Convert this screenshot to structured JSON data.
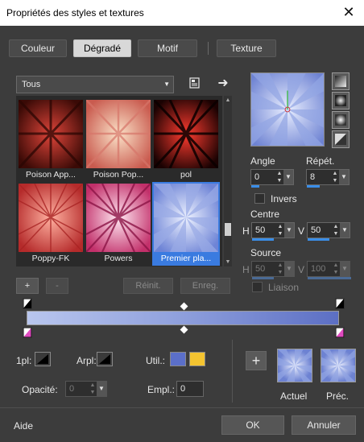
{
  "window": {
    "title": "Propriétés des styles et textures",
    "close_glyph": "✕"
  },
  "tabs": [
    {
      "label": "Couleur"
    },
    {
      "label": "Dégradé"
    },
    {
      "label": "Motif"
    },
    {
      "label": "Texture"
    }
  ],
  "category": {
    "value": "Tous"
  },
  "gallery": {
    "items": [
      {
        "label": "Poison App..."
      },
      {
        "label": "Poison Pop..."
      },
      {
        "label": "pol"
      },
      {
        "label": "Poppy-FK"
      },
      {
        "label": "Powers"
      },
      {
        "label": "Premier pla..."
      }
    ],
    "selected_index": 5
  },
  "gallery_buttons": {
    "add": "+",
    "remove": "-",
    "reset": "Réinit.",
    "save": "Enreg."
  },
  "angle": {
    "label": "Angle",
    "value": "0"
  },
  "repeat": {
    "label": "Répét.",
    "value": "8"
  },
  "invert": {
    "label": "Invers",
    "checked": false
  },
  "center": {
    "label": "Centre",
    "h_label": "H",
    "h_value": "50",
    "v_label": "V",
    "v_value": "50"
  },
  "source": {
    "label": "Source",
    "h_label": "H",
    "h_value": "50",
    "v_label": "V",
    "v_value": "100"
  },
  "link": {
    "label": "Liaison"
  },
  "gradient": {
    "start_color": "#b9c6ee",
    "mid_color": "#8e9fdc",
    "end_color": "#5c6fc4"
  },
  "bottom": {
    "fg_label": "1pl:",
    "bg_label": "Arpl:",
    "used_label": "Util.:",
    "used_colors": [
      "#5b6fc9",
      "#f4c430"
    ],
    "opacity_label": "Opacité:",
    "opacity_value": "0",
    "location_label": "Empl.:",
    "location_value": "0",
    "plus": "+",
    "current_label": "Actuel",
    "previous_label": "Préc."
  },
  "footer": {
    "help": "Aide",
    "ok": "OK",
    "cancel": "Annuler"
  }
}
